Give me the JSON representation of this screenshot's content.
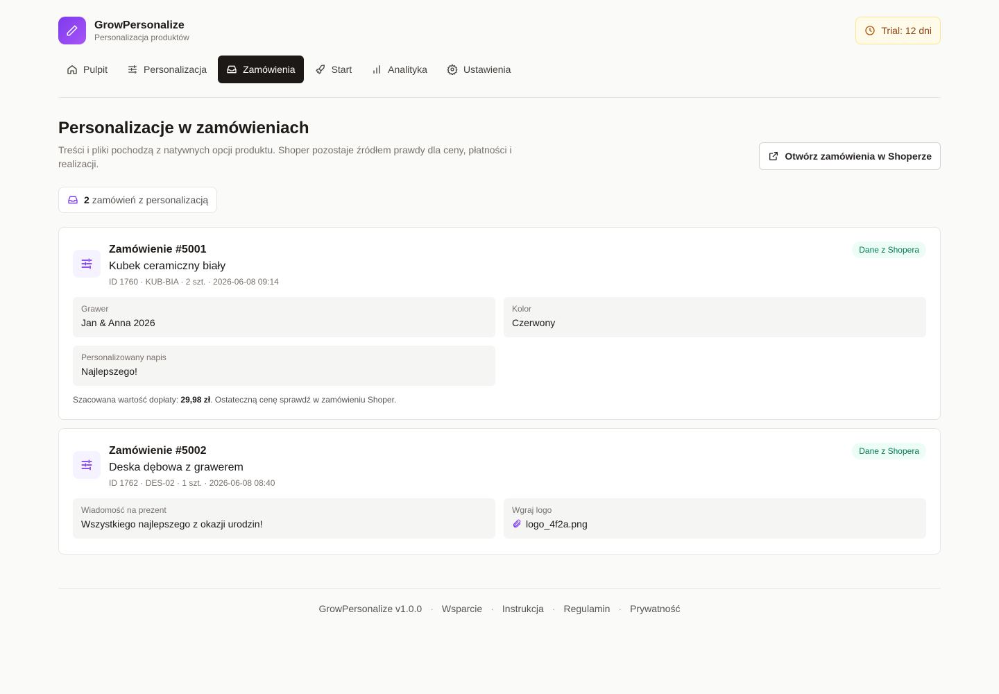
{
  "app": {
    "name": "GrowPersonalize",
    "subtitle": "Personalizacja produktów",
    "trial_label": "Trial: 12 dni"
  },
  "nav": {
    "items": [
      {
        "label": "Pulpit",
        "icon": "home-icon"
      },
      {
        "label": "Personalizacja",
        "icon": "sliders-icon"
      },
      {
        "label": "Zamówienia",
        "icon": "inbox-icon",
        "active": true
      },
      {
        "label": "Start",
        "icon": "rocket-icon"
      },
      {
        "label": "Analityka",
        "icon": "bar-chart-icon"
      },
      {
        "label": "Ustawienia",
        "icon": "gear-icon"
      }
    ]
  },
  "page": {
    "title": "Personalizacje w zamówieniach",
    "description": "Treści i pliki pochodzą z natywnych opcji produktu. Shoper pozostaje źródłem prawdy dla ceny, płatności i realizacji.",
    "open_button": "Otwórz zamówienia w Shoperze",
    "count": "2",
    "count_label": "zamówień z personalizacją"
  },
  "orders": [
    {
      "title": "Zamówienie #5001",
      "product": "Kubek ceramiczny biały",
      "meta": "ID 1760 · KUB-BIA · 2 szt. · 2026-06-08 09:14",
      "badge": "Dane z Shopera",
      "fields": [
        {
          "label": "Grawer",
          "value": "Jan & Anna 2026"
        },
        {
          "label": "Kolor",
          "value": "Czerwony"
        },
        {
          "label": "Personalizowany napis",
          "value": "Najlepszego!"
        }
      ],
      "surcharge_prefix": "Szacowana wartość dopłaty: ",
      "surcharge_value": "29,98 zł",
      "surcharge_suffix": ". Ostateczną cenę sprawdź w zamówieniu Shoper."
    },
    {
      "title": "Zamówienie #5002",
      "product": "Deska dębowa z grawerem",
      "meta": "ID 1762 · DES-02 · 1 szt. · 2026-06-08 08:40",
      "badge": "Dane z Shopera",
      "fields": [
        {
          "label": "Wiadomość na prezent",
          "value": "Wszystkiego najlepszego z okazji urodzin!"
        },
        {
          "label": "Wgraj logo",
          "value": "logo_4f2a.png",
          "icon": "paperclip-icon"
        }
      ]
    }
  ],
  "footer": {
    "version": "GrowPersonalize v1.0.0",
    "links": [
      "Wsparcie",
      "Instrukcja",
      "Regulamin",
      "Prywatność"
    ]
  },
  "colors": {
    "accent": "#7c3aed",
    "active_nav": "#1c1917",
    "badge_bg": "#ecfdf5",
    "badge_text": "#047857",
    "trial_bg": "#fffbeb"
  }
}
